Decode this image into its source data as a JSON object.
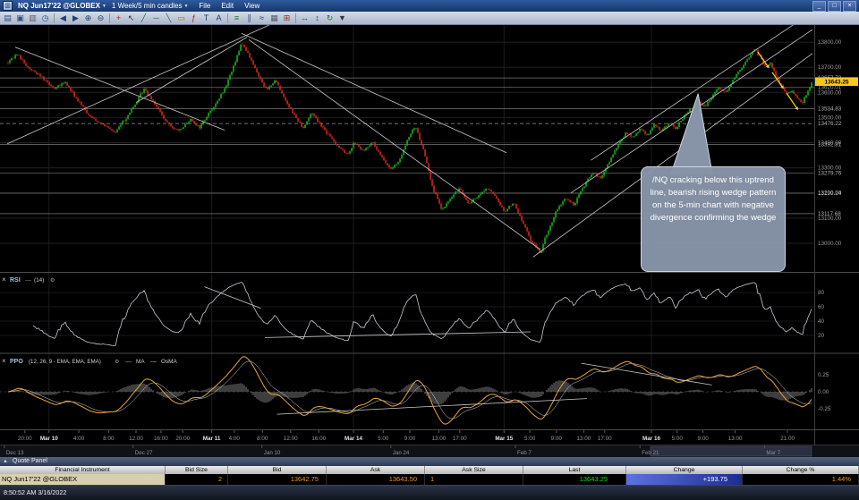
{
  "window": {
    "app_icon": "▥",
    "title_symbol": "NQ Jun17'22 @GLOBEX",
    "title_caret": "▼",
    "timeframe": "1 Week/5 min candles",
    "timeframe_caret": "▼",
    "menus": [
      "File",
      "Edit",
      "View"
    ],
    "window_buttons": [
      {
        "name": "minimize-button",
        "glyph": "_"
      },
      {
        "name": "maximize-button",
        "glyph": "□"
      },
      {
        "name": "close-button",
        "glyph": "×"
      }
    ]
  },
  "toolbar": {
    "icons": [
      {
        "name": "open-chartbook-icon",
        "glyph": "▤",
        "color": "#30507f"
      },
      {
        "name": "save-chartbook-icon",
        "glyph": "▣",
        "color": "#30507f"
      },
      {
        "name": "print-icon",
        "glyph": "▥",
        "color": "#5a5a6a"
      },
      {
        "name": "clock-icon",
        "glyph": "◷",
        "color": "#30507f"
      },
      {
        "sep": true
      },
      {
        "name": "prev-chart-icon",
        "glyph": "◀",
        "color": "#1f3f73"
      },
      {
        "name": "next-chart-icon",
        "glyph": "▶",
        "color": "#1f3f73"
      },
      {
        "name": "zoom-in-icon",
        "glyph": "⊕",
        "color": "#1f3f73"
      },
      {
        "name": "zoom-out-icon",
        "glyph": "⊖",
        "color": "#1f3f73"
      },
      {
        "sep": true
      },
      {
        "name": "crosshair-icon",
        "glyph": "+",
        "color": "#9a2c20"
      },
      {
        "name": "pointer-icon",
        "glyph": "↖",
        "color": "#333344"
      },
      {
        "name": "trendline-tool-icon",
        "glyph": "╱",
        "color": "#207a2c"
      },
      {
        "name": "horizontal-line-tool-icon",
        "glyph": "─",
        "color": "#207a2c"
      },
      {
        "name": "ray-tool-icon",
        "glyph": "╲",
        "color": "#207a2c"
      },
      {
        "name": "rectangle-tool-icon",
        "glyph": "▭",
        "color": "#9a7a20"
      },
      {
        "name": "fibonacci-tool-icon",
        "glyph": "ƒ",
        "color": "#9a2c20"
      },
      {
        "name": "text-tool-icon",
        "glyph": "T",
        "color": "#1f3f73"
      },
      {
        "name": "callout-tool-icon",
        "glyph": "A",
        "color": "#1f3f73"
      },
      {
        "sep": true
      },
      {
        "name": "candlestick-style-icon",
        "glyph": "≡",
        "color": "#207a2c"
      },
      {
        "name": "bar-style-icon",
        "glyph": "∥",
        "color": "#30507f"
      },
      {
        "name": "line-style-icon",
        "glyph": "≈",
        "color": "#1f3f73"
      },
      {
        "name": "grid-icon",
        "glyph": "▦",
        "color": "#5a5a6a"
      },
      {
        "name": "studies-icon",
        "glyph": "⊞",
        "color": "#9a2c20"
      },
      {
        "sep": true
      },
      {
        "name": "scale-horizontal-icon",
        "glyph": "↔",
        "color": "#1f3f73"
      },
      {
        "name": "scale-vertical-icon",
        "glyph": "↕",
        "color": "#1f3f73"
      },
      {
        "name": "refresh-icon",
        "glyph": "↻",
        "color": "#207a2c"
      },
      {
        "name": "tool-dropdown-icon",
        "glyph": "▼",
        "color": "#333344"
      }
    ]
  },
  "callout": {
    "text": "/NQ cracking below this uptrend line, bearish rising wedge pattern on the 5-min chart with negative divergence confirming the wedge"
  },
  "quote_panel": {
    "title": "Quote Panel",
    "collapse_glyph": "▲",
    "columns": [
      "Financial Instrument",
      "Bid Size",
      "Bid",
      "Ask",
      "Ask Size",
      "Last",
      "Change",
      "Change %"
    ],
    "row": {
      "instrument": "NQ Jun17'22 @GLOBEX",
      "bid_size": "2",
      "bid": "13642.75",
      "ask": "13643.50",
      "ask_size": "1",
      "last": "13643.25",
      "change": "+193.75",
      "change_pct": "1.44%"
    }
  },
  "status_bar": {
    "text": "8:50:52 AM 3/16/2022"
  },
  "chart_data": [
    {
      "type": "candlestick",
      "symbol": "NQ Jun17'22 @GLOBEX",
      "timeframe": "1 Week/5 min candles",
      "candle_count": 450,
      "up_color": "#17bd1c",
      "down_color": "#dd2c1c",
      "y_axis": {
        "gridlines": [
          13800,
          13700,
          13600,
          13500,
          13400,
          13300,
          13200,
          13100,
          13000
        ],
        "special_levels": [
          {
            "p": 13657.73,
            "dashed": false
          },
          {
            "p": 13620.01,
            "dashed": false
          },
          {
            "p": 13534.83,
            "dashed": false
          },
          {
            "p": 13476.22,
            "dashed": true
          },
          {
            "p": 13392.81,
            "dashed": false
          },
          {
            "p": 13279.76,
            "dashed": false
          },
          {
            "p": 13199.24,
            "dashed": false
          },
          {
            "p": 13117.68,
            "dashed": false
          }
        ],
        "last_price": 13643.25,
        "last_price_bg": "#f5c81c"
      },
      "anchors": [
        [
          0.0,
          13720
        ],
        [
          0.011,
          13755
        ],
        [
          0.024,
          13700
        ],
        [
          0.041,
          13665
        ],
        [
          0.058,
          13615
        ],
        [
          0.071,
          13640
        ],
        [
          0.086,
          13570
        ],
        [
          0.102,
          13505
        ],
        [
          0.119,
          13470
        ],
        [
          0.133,
          13440
        ],
        [
          0.147,
          13500
        ],
        [
          0.16,
          13560
        ],
        [
          0.169,
          13615
        ],
        [
          0.182,
          13560
        ],
        [
          0.197,
          13480
        ],
        [
          0.213,
          13445
        ],
        [
          0.227,
          13495
        ],
        [
          0.238,
          13460
        ],
        [
          0.249,
          13515
        ],
        [
          0.26,
          13560
        ],
        [
          0.271,
          13625
        ],
        [
          0.282,
          13715
        ],
        [
          0.291,
          13800
        ],
        [
          0.3,
          13745
        ],
        [
          0.311,
          13670
        ],
        [
          0.322,
          13610
        ],
        [
          0.333,
          13648
        ],
        [
          0.344,
          13575
        ],
        [
          0.356,
          13510
        ],
        [
          0.367,
          13458
        ],
        [
          0.378,
          13520
        ],
        [
          0.389,
          13472
        ],
        [
          0.4,
          13425
        ],
        [
          0.411,
          13385
        ],
        [
          0.422,
          13352
        ],
        [
          0.431,
          13400
        ],
        [
          0.442,
          13365
        ],
        [
          0.453,
          13405
        ],
        [
          0.464,
          13345
        ],
        [
          0.476,
          13295
        ],
        [
          0.487,
          13325
        ],
        [
          0.498,
          13420
        ],
        [
          0.507,
          13465
        ],
        [
          0.518,
          13360
        ],
        [
          0.529,
          13215
        ],
        [
          0.54,
          13130
        ],
        [
          0.551,
          13180
        ],
        [
          0.562,
          13222
        ],
        [
          0.573,
          13155
        ],
        [
          0.584,
          13185
        ],
        [
          0.596,
          13222
        ],
        [
          0.607,
          13182
        ],
        [
          0.618,
          13125
        ],
        [
          0.629,
          13162
        ],
        [
          0.64,
          13085
        ],
        [
          0.651,
          13010
        ],
        [
          0.662,
          12960
        ],
        [
          0.671,
          13040
        ],
        [
          0.682,
          13125
        ],
        [
          0.693,
          13180
        ],
        [
          0.704,
          13152
        ],
        [
          0.716,
          13225
        ],
        [
          0.727,
          13285
        ],
        [
          0.738,
          13255
        ],
        [
          0.749,
          13330
        ],
        [
          0.76,
          13395
        ],
        [
          0.769,
          13440
        ],
        [
          0.778,
          13420
        ],
        [
          0.787,
          13455
        ],
        [
          0.796,
          13430
        ],
        [
          0.804,
          13472
        ],
        [
          0.813,
          13445
        ],
        [
          0.822,
          13480
        ],
        [
          0.831,
          13455
        ],
        [
          0.84,
          13500
        ],
        [
          0.849,
          13530
        ],
        [
          0.858,
          13560
        ],
        [
          0.867,
          13545
        ],
        [
          0.876,
          13585
        ],
        [
          0.884,
          13620
        ],
        [
          0.893,
          13600
        ],
        [
          0.902,
          13650
        ],
        [
          0.911,
          13690
        ],
        [
          0.92,
          13730
        ],
        [
          0.929,
          13775
        ],
        [
          0.936,
          13740
        ],
        [
          0.942,
          13700
        ],
        [
          0.949,
          13720
        ],
        [
          0.956,
          13660
        ],
        [
          0.962,
          13630
        ],
        [
          0.969,
          13590
        ],
        [
          0.976,
          13610
        ],
        [
          0.982,
          13575
        ],
        [
          0.989,
          13560
        ],
        [
          1.0,
          13640
        ]
      ],
      "trendlines": [
        [
          0.0,
          13395,
          0.33,
          13875
        ],
        [
          0.16,
          13560,
          0.298,
          13820
        ],
        [
          0.291,
          13835,
          0.62,
          13360
        ],
        [
          0.3,
          13810,
          0.662,
          12975
        ],
        [
          0.01,
          13780,
          0.27,
          13450
        ],
        [
          0.653,
          12945,
          1.0,
          13755
        ],
        [
          0.7,
          13200,
          1.0,
          13850
        ],
        [
          0.725,
          13330,
          1.0,
          13920
        ]
      ],
      "breakdown_arrows": [
        [
          0.932,
          13762,
          0.944,
          13706
        ],
        [
          0.95,
          13680,
          0.962,
          13624
        ],
        [
          0.968,
          13596,
          0.98,
          13540
        ]
      ],
      "callout_tail": [
        0.858,
        13595
      ],
      "time_axis": {
        "labels": [
          [
            "20:00",
            0.022,
            0
          ],
          [
            "Mar 10",
            0.052,
            1
          ],
          [
            "4:00",
            0.089,
            0
          ],
          [
            "8:00",
            0.126,
            0
          ],
          [
            "12:00",
            0.16,
            0
          ],
          [
            "16:00",
            0.191,
            0
          ],
          [
            "20:00",
            0.218,
            0
          ],
          [
            "Mar 11",
            0.254,
            1
          ],
          [
            "4:00",
            0.282,
            0
          ],
          [
            "8:00",
            0.317,
            0
          ],
          [
            "12:00",
            0.352,
            0
          ],
          [
            "16:00",
            0.387,
            0
          ],
          [
            "Mar 14",
            0.43,
            1
          ],
          [
            "5:00",
            0.467,
            0
          ],
          [
            "9:00",
            0.5,
            0
          ],
          [
            "13:00",
            0.536,
            0
          ],
          [
            "17:00",
            0.562,
            0
          ],
          [
            "Mar 15",
            0.617,
            1
          ],
          [
            "5:00",
            0.649,
            0
          ],
          [
            "9:00",
            0.682,
            0
          ],
          [
            "13:00",
            0.716,
            0
          ],
          [
            "17:00",
            0.742,
            0
          ],
          [
            "Mar 16",
            0.8,
            1
          ],
          [
            "5:00",
            0.832,
            0
          ],
          [
            "9:00",
            0.864,
            0
          ],
          [
            "13:00",
            0.904,
            0
          ],
          [
            "21:00",
            0.969,
            0
          ]
        ]
      },
      "day_line_fracs": [
        0.052,
        0.254,
        0.43,
        0.617,
        0.8
      ],
      "mini_timeline": {
        "labels": [
          [
            "Dec 13",
            0.005
          ],
          [
            "Dec 27",
            0.155
          ],
          [
            "Jan 10",
            0.305
          ],
          [
            "Jan 24",
            0.455
          ],
          [
            "Feb 7",
            0.6
          ],
          [
            "Feb 21",
            0.745
          ],
          [
            "Mar 7",
            0.89
          ]
        ],
        "window": [
          0.757,
          0.945
        ]
      }
    },
    {
      "type": "line",
      "name": "RSI",
      "params": "(14)",
      "period": 14,
      "color": "#c3c9d3",
      "scale_labels": [
        80,
        60,
        40,
        20
      ],
      "trendlines": [
        [
          0.245,
          88,
          0.315,
          58
        ],
        [
          0.32,
          17,
          0.65,
          25
        ]
      ],
      "derived_from": "candles"
    },
    {
      "type": "line+histogram",
      "name": "PPO",
      "params": "(12, 26, 9 - EMA, EMA, EMA)",
      "fast": 12,
      "slow": 26,
      "signal": 9,
      "line_color": "#e8a33d",
      "signal_color": "#d9d9d9",
      "hist_color": "#606060",
      "scale_labels": [
        0.25,
        0,
        -0.25
      ],
      "legend": [
        "MA",
        "OsMA"
      ],
      "trendlines": [
        [
          0.713,
          0.42,
          0.875,
          0.1
        ],
        [
          0.335,
          -0.33,
          0.72,
          -0.1
        ]
      ],
      "derived_from": "candles"
    }
  ]
}
